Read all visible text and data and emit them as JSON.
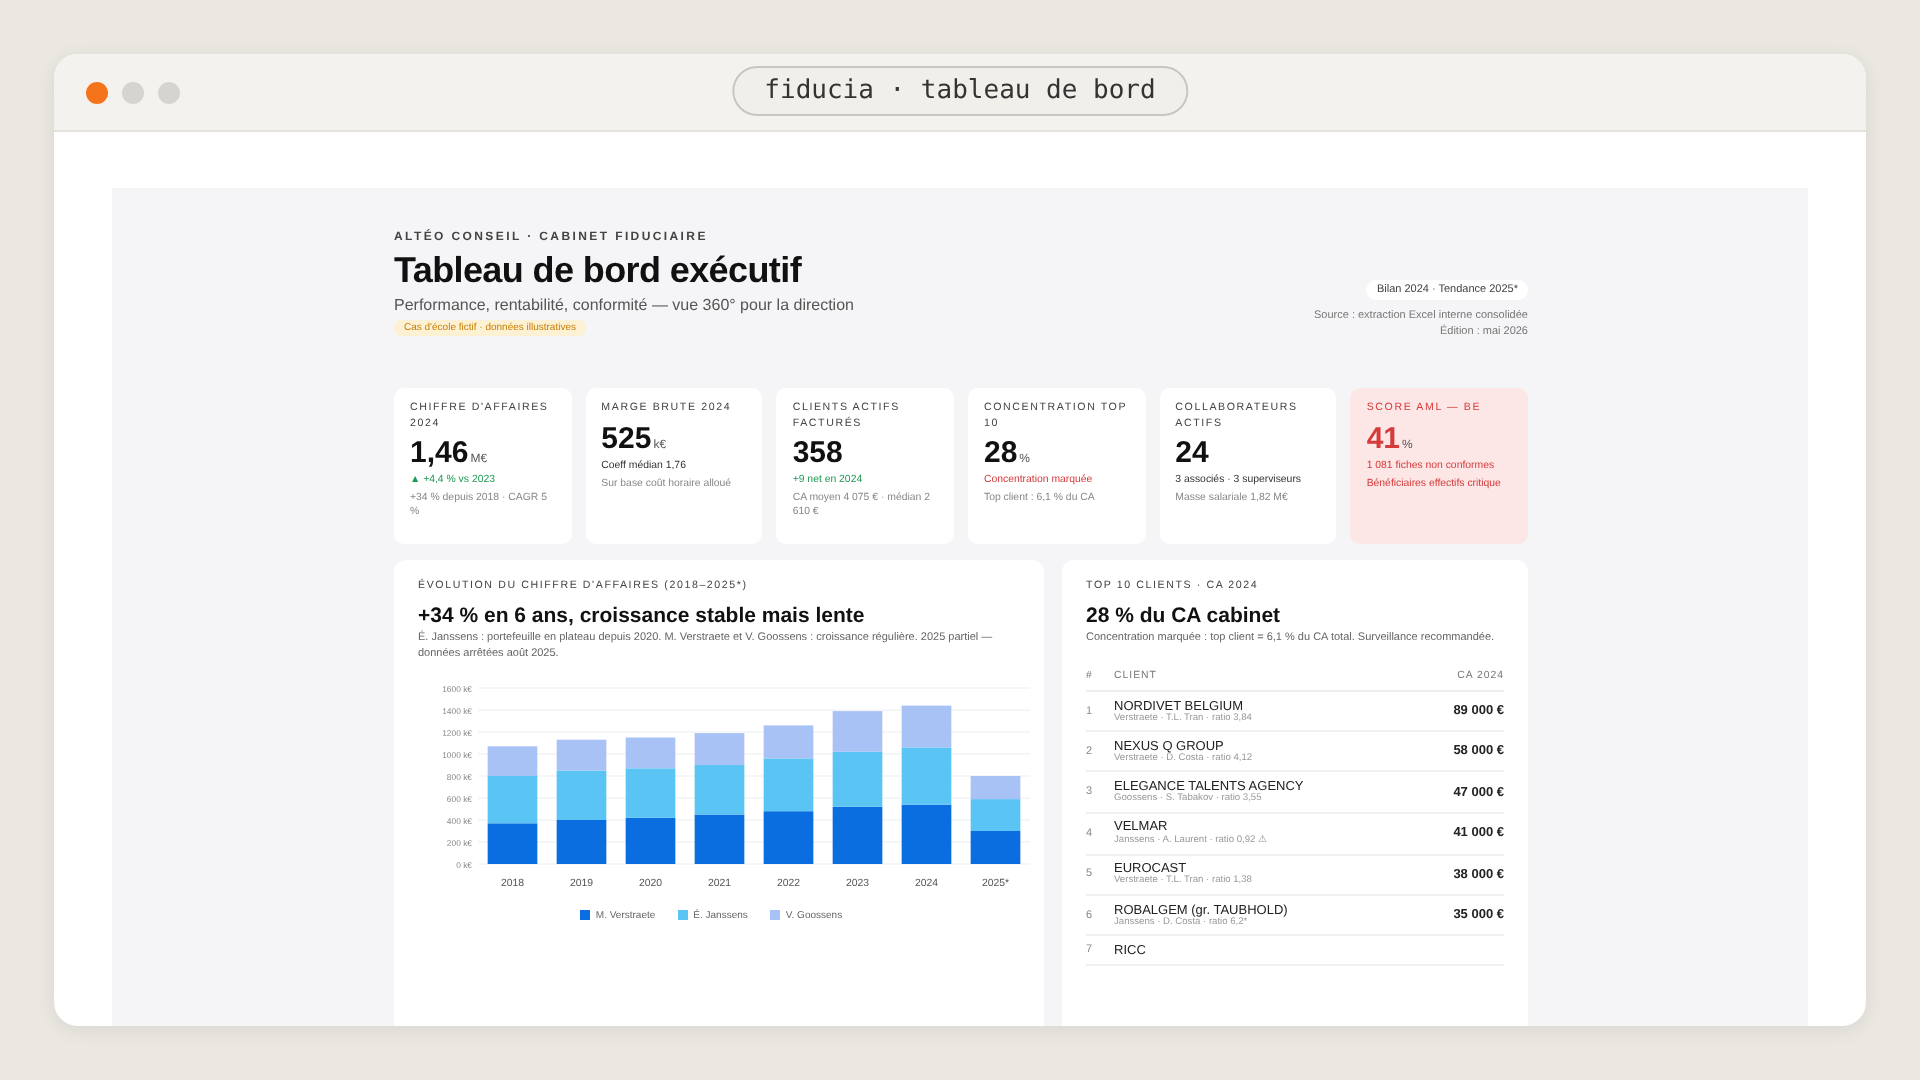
{
  "window": {
    "title": "fiducia · tableau de bord"
  },
  "header": {
    "eyebrow": "ALTÉO CONSEIL · CABINET FIDUCIAIRE",
    "title": "Tableau de bord exécutif",
    "subtitle": "Performance, rentabilité, conformité — vue 360° pour la direction",
    "tag": "Cas d'école fictif · données illustratives",
    "period": "Bilan 2024 · Tendance 2025*",
    "source": "Source : extraction Excel interne consolidée",
    "edition": "Édition : mai 2026"
  },
  "kpis": [
    {
      "kind": "normal",
      "label": "CHIFFRE D'AFFAIRES 2024",
      "value": "1,46",
      "unit": "M€",
      "lines": [
        {
          "kind": "up",
          "text": "▲ +4,4 % vs 2023"
        },
        {
          "kind": "muted",
          "text": "+34 % depuis 2018 · CAGR 5 %"
        }
      ]
    },
    {
      "kind": "normal",
      "label": "MARGE BRUTE 2024",
      "value": "525",
      "unit": "k€",
      "lines": [
        {
          "kind": "dark",
          "text": "Coeff médian 1,76"
        },
        {
          "kind": "muted",
          "text": "Sur base coût horaire alloué"
        }
      ]
    },
    {
      "kind": "normal",
      "label": "CLIENTS ACTIFS FACTURÉS",
      "value": "358",
      "lines": [
        {
          "kind": "up",
          "text": "+9 net en 2024"
        },
        {
          "kind": "muted",
          "text": "CA moyen 4 075 € · médian 2 610 €"
        }
      ]
    },
    {
      "kind": "normal",
      "label": "CONCENTRATION TOP 10",
      "value": "28",
      "unit": "%",
      "lines": [
        {
          "kind": "warn",
          "text": "Concentration marquée"
        },
        {
          "kind": "muted",
          "text": "Top client : 6,1 % du CA"
        }
      ]
    },
    {
      "kind": "normal",
      "label": "COLLABORATEURS ACTIFS",
      "value": "24",
      "lines": [
        {
          "kind": "dark",
          "text": "3 associés · 3 superviseurs"
        },
        {
          "kind": "muted",
          "text": "Masse salariale 1,82 M€"
        }
      ]
    },
    {
      "kind": "alert",
      "label": "SCORE AML — BE",
      "value": "41",
      "unit": "%",
      "lines": [
        {
          "kind": "warn",
          "text": "1 081 fiches non conformes"
        },
        {
          "kind": "warn",
          "text": "Bénéficiaires effectifs critique"
        }
      ]
    }
  ],
  "revenue": {
    "eyebrow": "ÉVOLUTION DU CHIFFRE D'AFFAIRES (2018–2025*)",
    "title": "+34 % en 6 ans, croissance stable mais lente",
    "note": "É. Janssens : portefeuille en plateau depuis 2020. M. Verstraete et V. Goossens : croissance régulière. 2025 partiel — données arrêtées août 2025.",
    "chart_data": {
      "type": "bar",
      "stacked": true,
      "grid": true,
      "categories": [
        "2018",
        "2019",
        "2020",
        "2021",
        "2022",
        "2023",
        "2024",
        "2025*"
      ],
      "series": [
        {
          "name": "M. Verstraete",
          "color": "#0a6ee0",
          "values": [
            370,
            400,
            420,
            450,
            480,
            520,
            540,
            300
          ]
        },
        {
          "name": "É. Janssens",
          "color": "#5ac4f5",
          "values": [
            430,
            450,
            450,
            450,
            480,
            500,
            520,
            290
          ]
        },
        {
          "name": "V. Goossens",
          "color": "#a9c2f5",
          "values": [
            270,
            280,
            280,
            290,
            300,
            370,
            380,
            210
          ]
        }
      ],
      "ylim": [
        0,
        1600
      ],
      "yticks": [
        {
          "value": 0,
          "label": "0 k€"
        },
        {
          "value": 200,
          "label": "200 k€"
        },
        {
          "value": 400,
          "label": "400 k€"
        },
        {
          "value": 600,
          "label": "600 k€"
        },
        {
          "value": 800,
          "label": "800 k€"
        },
        {
          "value": 1000,
          "label": "1000 k€"
        },
        {
          "value": 1200,
          "label": "1200 k€"
        },
        {
          "value": 1400,
          "label": "1400 k€"
        },
        {
          "value": 1600,
          "label": "1600 k€"
        }
      ]
    }
  },
  "clients": {
    "eyebrow": "TOP 10 CLIENTS · CA 2024",
    "title": "28 % du CA cabinet",
    "note": "Concentration marquée : top client = 6,1 % du CA total. Surveillance recommandée.",
    "columns": [
      "#",
      "CLIENT",
      "CA 2024"
    ],
    "rows": [
      {
        "rank": "1",
        "name": "NORDIVET BELGIUM",
        "detail": "Verstraete · T.L. Tran · ratio 3,84",
        "amount": "89 000 €"
      },
      {
        "rank": "2",
        "name": "NEXUS Q GROUP",
        "detail": "Verstraete · D. Costa · ratio 4,12",
        "amount": "58 000 €"
      },
      {
        "rank": "3",
        "name": "ELEGANCE TALENTS AGENCY",
        "detail": "Goossens · S. Tabakov · ratio 3,55",
        "amount": "47 000 €"
      },
      {
        "rank": "4",
        "name": "VELMAR",
        "detail": "Janssens · A. Laurent · ratio 0,92 ⚠",
        "amount": "41 000 €"
      },
      {
        "rank": "5",
        "name": "EUROCAST",
        "detail": "Verstraete · T.L. Tran · ratio 1,38",
        "amount": "38 000 €"
      },
      {
        "rank": "6",
        "name": "ROBALGEM (gr. TAUBHOLD)",
        "detail": "Janssens · D. Costa · ratio 6,2*",
        "amount": "35 000 €"
      },
      {
        "rank": "7",
        "name": "RICC"
      }
    ]
  }
}
